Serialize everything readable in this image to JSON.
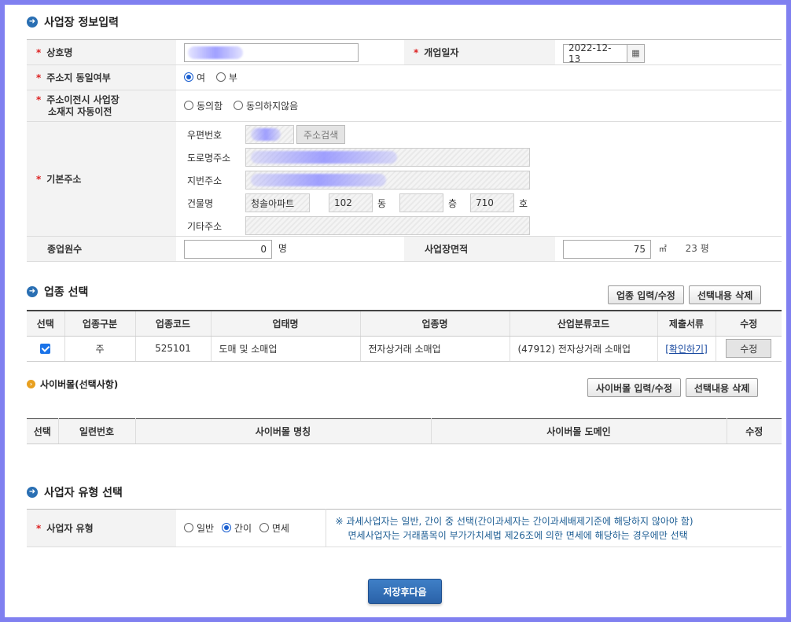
{
  "sections": {
    "info_title": "사업장 정보입력",
    "biztype_title": "업종 선택",
    "cyber_title": "사이버몰(선택사항)",
    "taxpayer_title": "사업자 유형 선택"
  },
  "info": {
    "required_mark": "*",
    "trade_name_label": "상호명",
    "open_date_label": "개업일자",
    "open_date_value": "2022-12-13",
    "same_address_label": "주소지 동일여부",
    "same_address_options": [
      "여",
      "부"
    ],
    "auto_move_label_1": "주소이전시 사업장",
    "auto_move_label_2": "소재지 자동이전",
    "auto_move_options": [
      "동의함",
      "동의하지않음"
    ],
    "address_label": "기본주소",
    "postcode_label": "우편번호",
    "postcode_search_button": "주소검색",
    "road_address_label": "도로명주소",
    "lot_address_label": "지번주소",
    "building_label": "건물명",
    "building_name": "청솔아파트",
    "dong_value": "102",
    "dong_unit": "동",
    "floor_value": "",
    "floor_unit": "층",
    "ho_value": "710",
    "ho_unit": "호",
    "etc_address_label": "기타주소",
    "employees_label": "종업원수",
    "employees_value": "0",
    "employees_unit": "명",
    "area_label": "사업장면적",
    "area_value": "75",
    "area_unit": "㎡",
    "area_pyeong": "23 평"
  },
  "biztype": {
    "edit_button": "업종 입력/수정",
    "delete_button": "선택내용 삭제",
    "columns": [
      "선택",
      "업종구분",
      "업종코드",
      "업태명",
      "업종명",
      "산업분류코드",
      "제출서류",
      "수정"
    ],
    "rows": [
      {
        "category": "주",
        "code": "525101",
        "business_type": "도매 및 소매업",
        "item": "전자상거래 소매업",
        "industry_code": "(47912) 전자상거래 소매업",
        "document_link": "[확인하기]",
        "edit_button": "수정"
      }
    ]
  },
  "cyber": {
    "edit_button": "사이버몰 입력/수정",
    "delete_button": "선택내용 삭제",
    "columns": [
      "선택",
      "일련번호",
      "사이버몰 명칭",
      "사이버몰 도메인",
      "수정"
    ]
  },
  "taxpayer": {
    "label": "사업자 유형",
    "options": [
      "일반",
      "간이",
      "면세"
    ],
    "notice_1": "※ 과세사업자는 일반, 간이 중 선택(간이과세자는 간이과세배제기준에 해당하지 않아야 함)",
    "notice_2": "면세사업자는 거래품목이 부가가치세법 제26조에 의한 면세에 해당하는 경우에만 선택"
  },
  "footer": {
    "save_next_button": "저장후다음"
  }
}
